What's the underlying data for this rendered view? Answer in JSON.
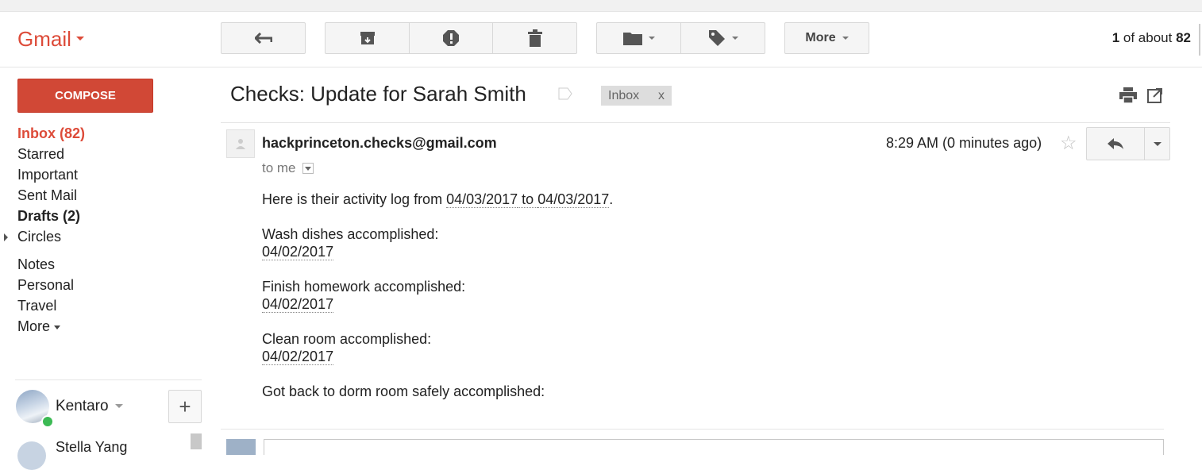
{
  "header": {
    "logo": "Gmail",
    "more_label": "More",
    "pager": {
      "current": "1",
      "of_about": "of about",
      "total": "82"
    }
  },
  "sidebar": {
    "compose_label": "COMPOSE",
    "items": [
      {
        "label": "Inbox (82)"
      },
      {
        "label": "Starred"
      },
      {
        "label": "Important"
      },
      {
        "label": "Sent Mail"
      },
      {
        "label": "Drafts (2)"
      },
      {
        "label": "Circles"
      },
      {
        "label": "Notes"
      },
      {
        "label": "Personal"
      },
      {
        "label": "Travel"
      },
      {
        "label": "More"
      }
    ],
    "user": {
      "name": "Kentaro"
    },
    "contacts": [
      {
        "name": "Stella Yang"
      }
    ],
    "add_label": "+"
  },
  "message": {
    "subject": "Checks: Update for Sarah Smith",
    "label_chip": {
      "label": "Inbox",
      "remove": "x"
    },
    "sender": "hackprinceton.checks@gmail.com",
    "to": "to me",
    "time": "8:29 AM (0 minutes ago)",
    "star": "☆",
    "body": {
      "intro_prefix": "Here is their activity log from ",
      "date_from": "04/03/2017",
      "to_word": " to ",
      "date_to": "04/03/2017",
      "intro_suffix": ".",
      "entries": [
        {
          "title": "Wash dishes accomplished:",
          "date": "04/02/2017"
        },
        {
          "title": "Finish homework accomplished:",
          "date": "04/02/2017"
        },
        {
          "title": "Clean room accomplished:",
          "date": "04/02/2017"
        },
        {
          "title": "Got back to dorm room safely accomplished:",
          "date": ""
        }
      ]
    }
  },
  "colors": {
    "accent": "#dd4b39",
    "compose_bg": "#d14836",
    "online": "#3cba54"
  }
}
